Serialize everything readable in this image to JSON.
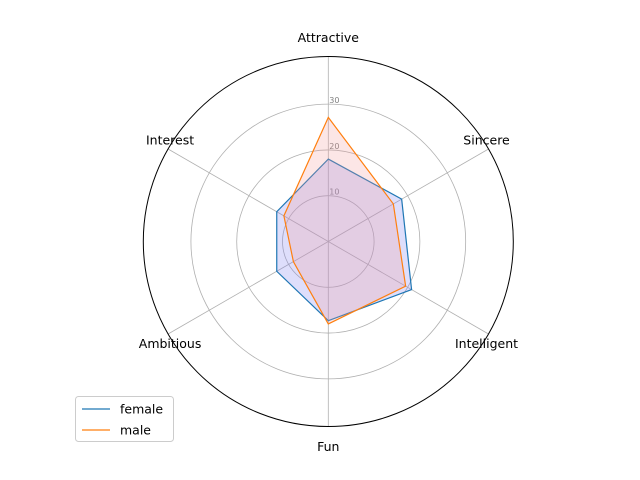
{
  "chart_data": {
    "type": "radar",
    "categories": [
      "Attractive",
      "Sincere",
      "Intelligent",
      "Fun",
      "Ambitious",
      "Interest"
    ],
    "series": [
      {
        "name": "female",
        "values": [
          18.0,
          18.5,
          21.0,
          17.3,
          13.0,
          13.0
        ],
        "color": "#1f77b4",
        "fill": "#7b7bf0"
      },
      {
        "name": "male",
        "values": [
          27.1,
          16.4,
          19.5,
          18.0,
          8.8,
          11.2
        ],
        "color": "#ff7f0e",
        "fill": "#f59a9a"
      }
    ],
    "radial_ticks": [
      "10",
      "20",
      "30"
    ],
    "radial_tick_values": [
      10,
      20,
      30
    ],
    "rmax": 40.4,
    "grid": true,
    "legend_placement": "lower-left"
  }
}
